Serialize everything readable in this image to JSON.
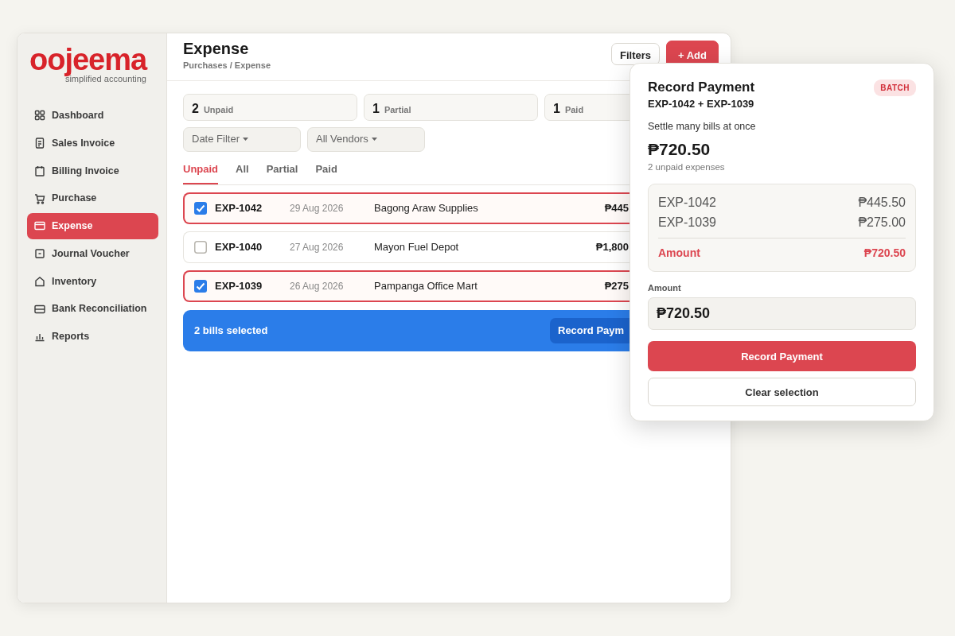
{
  "logo": {
    "name": "oojeema",
    "tagline": "simplified accounting"
  },
  "sidebar": {
    "items": [
      {
        "label": "Dashboard",
        "selected": false
      },
      {
        "label": "Sales Invoice",
        "selected": false
      },
      {
        "label": "Billing Invoice",
        "selected": false
      },
      {
        "label": "Purchase",
        "selected": false
      },
      {
        "label": "Expense",
        "selected": true
      },
      {
        "label": "Journal Voucher",
        "selected": false
      },
      {
        "label": "Inventory",
        "selected": false
      },
      {
        "label": "Bank Reconciliation",
        "selected": false
      },
      {
        "label": "Reports",
        "selected": false
      }
    ]
  },
  "header": {
    "title": "Expense",
    "breadcrumb": "Purchases / Expense",
    "buttons": [
      {
        "label": "Filters",
        "kind": "outline"
      },
      {
        "label": "+ Add",
        "kind": "primary"
      }
    ]
  },
  "stats": [
    {
      "count": "2",
      "label": "Unpaid"
    },
    {
      "count": "1",
      "label": "Partial"
    },
    {
      "count": "1",
      "label": "Paid"
    }
  ],
  "filters": [
    {
      "label": "Date Filter"
    },
    {
      "label": "All Vendors"
    }
  ],
  "tabs": [
    {
      "label": "Unpaid",
      "selected": true
    },
    {
      "label": "All",
      "selected": false
    },
    {
      "label": "Partial",
      "selected": false
    },
    {
      "label": "Paid",
      "selected": false
    }
  ],
  "rows": [
    {
      "id": "EXP-1042",
      "date": "29 Aug 2026",
      "vendor": "Bagong Araw Supplies",
      "amount": "₱445",
      "selected": true
    },
    {
      "id": "EXP-1040",
      "date": "27 Aug 2026",
      "vendor": "Mayon Fuel Depot",
      "amount": "₱1,800",
      "selected": false
    },
    {
      "id": "EXP-1039",
      "date": "26 Aug 2026",
      "vendor": "Pampanga Office Mart",
      "amount": "₱275",
      "selected": true
    }
  ],
  "bulk_bar": {
    "text": "2 bills selected",
    "button": "Record Paym"
  },
  "payment_panel": {
    "title": "Record Payment",
    "badge": "BATCH",
    "subtitle": "EXP-1042 + EXP-1039",
    "description": "Settle many bills at once",
    "total": "₱720.50",
    "count_text": "2 unpaid expenses",
    "lines": [
      {
        "id": "EXP-1042",
        "amount": "₱445.50"
      },
      {
        "id": "EXP-1039",
        "amount": "₱275.00"
      }
    ],
    "sum": {
      "label": "Amount",
      "amount": "₱720.50"
    },
    "field": {
      "label": "Amount",
      "value": "₱720.50"
    },
    "primary_button": "Record Payment",
    "secondary_button": "Clear selection"
  }
}
